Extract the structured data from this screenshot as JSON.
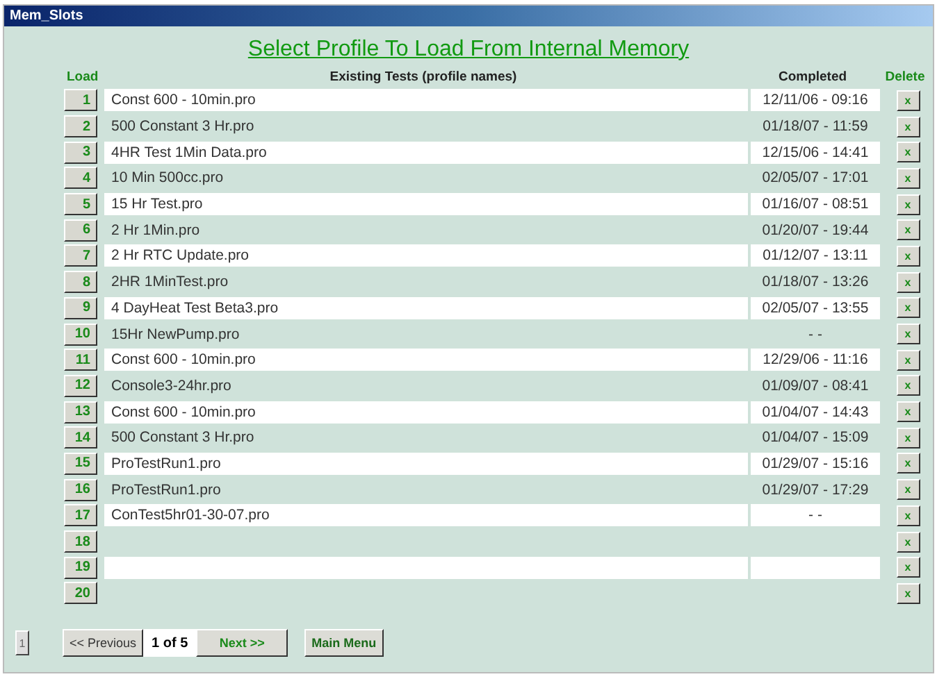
{
  "window": {
    "title": "Mem_Slots"
  },
  "heading": "Select Profile To Load From Internal Memory",
  "columns": {
    "load": "Load",
    "name": "Existing Tests (profile names)",
    "completed": "Completed",
    "delete": "Delete"
  },
  "rows": [
    {
      "slot": "1",
      "name": "Const 600 - 10min.pro",
      "completed": "12/11/06 - 09:16",
      "delete": "x"
    },
    {
      "slot": "2",
      "name": "500 Constant 3 Hr.pro",
      "completed": "01/18/07 - 11:59",
      "delete": "x"
    },
    {
      "slot": "3",
      "name": "4HR Test 1Min Data.pro",
      "completed": "12/15/06 - 14:41",
      "delete": "x"
    },
    {
      "slot": "4",
      "name": "10 Min 500cc.pro",
      "completed": "02/05/07 - 17:01",
      "delete": "x"
    },
    {
      "slot": "5",
      "name": "15 Hr Test.pro",
      "completed": "01/16/07 - 08:51",
      "delete": "x"
    },
    {
      "slot": "6",
      "name": "2 Hr 1Min.pro",
      "completed": "01/20/07 - 19:44",
      "delete": "x"
    },
    {
      "slot": "7",
      "name": "2 Hr RTC Update.pro",
      "completed": "01/12/07 - 13:11",
      "delete": "x"
    },
    {
      "slot": "8",
      "name": "2HR 1MinTest.pro",
      "completed": "01/18/07 - 13:26",
      "delete": "x"
    },
    {
      "slot": "9",
      "name": "4 DayHeat Test Beta3.pro",
      "completed": "02/05/07 - 13:55",
      "delete": "x"
    },
    {
      "slot": "10",
      "name": "15Hr NewPump.pro",
      "completed": "- -",
      "delete": "x"
    },
    {
      "slot": "11",
      "name": "Const 600 - 10min.pro",
      "completed": "12/29/06 - 11:16",
      "delete": "x"
    },
    {
      "slot": "12",
      "name": "Console3-24hr.pro",
      "completed": "01/09/07 - 08:41",
      "delete": "x"
    },
    {
      "slot": "13",
      "name": "Const 600 - 10min.pro",
      "completed": "01/04/07 - 14:43",
      "delete": "x"
    },
    {
      "slot": "14",
      "name": "500 Constant 3 Hr.pro",
      "completed": "01/04/07 - 15:09",
      "delete": "x"
    },
    {
      "slot": "15",
      "name": "ProTestRun1.pro",
      "completed": "01/29/07 - 15:16",
      "delete": "x"
    },
    {
      "slot": "16",
      "name": "ProTestRun1.pro",
      "completed": "01/29/07 - 17:29",
      "delete": "x"
    },
    {
      "slot": "17",
      "name": "ConTest5hr01-30-07.pro",
      "completed": "- -",
      "delete": "x"
    },
    {
      "slot": "18",
      "delete": "x"
    },
    {
      "slot": "19",
      "delete": "x"
    },
    {
      "slot": "20",
      "delete": "x"
    }
  ],
  "side_button": "1",
  "pager": {
    "previous": "<< Previous",
    "page": "1 of 5",
    "next": "Next >>",
    "main_menu": "Main Menu"
  }
}
